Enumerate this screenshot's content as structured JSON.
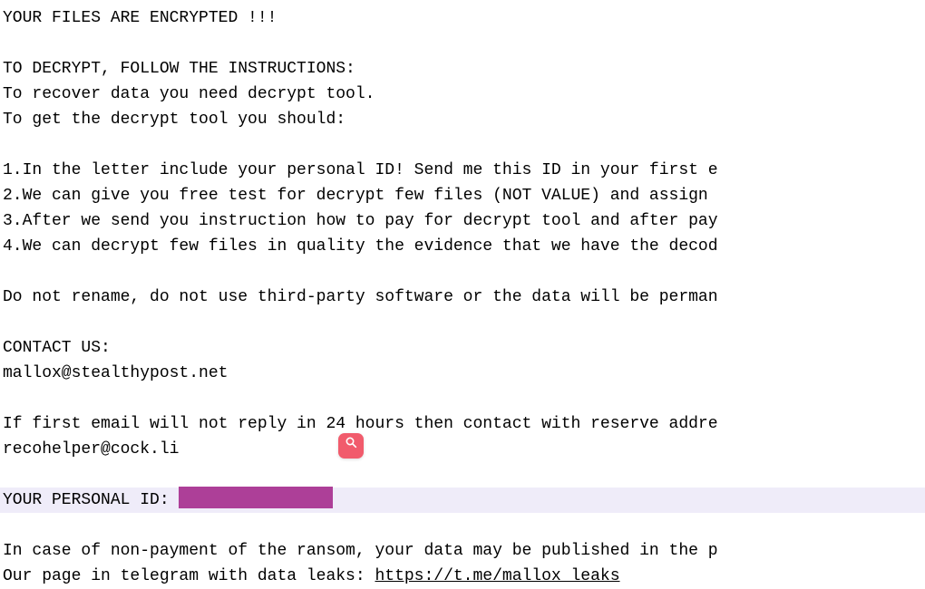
{
  "note": {
    "title": "YOUR FILES ARE ENCRYPTED !!!",
    "heading": "TO DECRYPT, FOLLOW THE INSTRUCTIONS:",
    "intro1": "To recover data you need decrypt tool.",
    "intro2": "To get the decrypt tool you should:",
    "steps": [
      "1.In the letter include your personal ID! Send me this ID in your first e",
      "2.We can give you free test for decrypt few files (NOT VALUE) and assign ",
      "3.After we send you instruction how to pay for decrypt tool and after pay",
      "4.We can decrypt few files in quality the evidence that we have the decod"
    ],
    "warning": "Do not rename, do not use third-party software or the data will be perman",
    "contact_label": "CONTACT US:",
    "contact_email": "mallox@stealthypost.net",
    "alt_contact": "If first email will not reply in 24 hours then contact with reserve addre",
    "alt_email": "recohelper@cock.li",
    "personal_id_label": "YOUR PERSONAL ID: ",
    "nonpayment": "In case of non-payment of the ransom, your data may be published in the p",
    "leaks_prefix": "Our page in telegram with data leaks: ",
    "leaks_link": "https://t.me/mallox_leaks"
  },
  "ui": {
    "overlay_icon": "search-icon"
  }
}
